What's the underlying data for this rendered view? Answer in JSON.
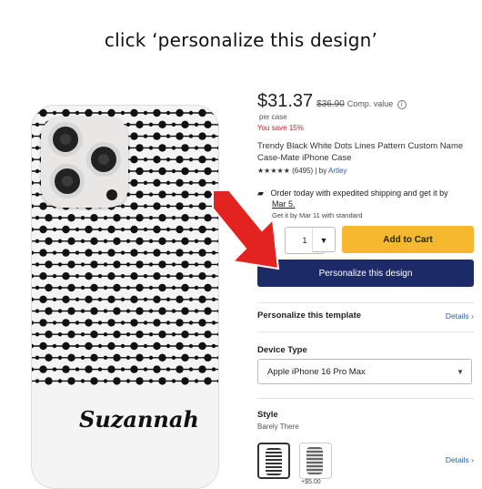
{
  "caption": "click ‘personalize this design’",
  "product": {
    "price": "$31.37",
    "original_price": "$36.90",
    "comp_value": "Comp. value",
    "per_unit": "per case",
    "savings": "You save 15%",
    "title": "Trendy Black White Dots Lines Pattern Custom Name Case-Mate iPhone Case",
    "stars": "★★★★★",
    "rating_count": "(6495)",
    "by_label": "| by",
    "author": "Artley",
    "personalized_name": "Suzannah"
  },
  "shipping": {
    "line1": "Order today with expedited shipping and get it by",
    "date": "Mar 5.",
    "line2": "Get it by Mar 11 with standard"
  },
  "purchase": {
    "quantity": "1",
    "add_to_cart": "Add to Cart",
    "personalize": "Personalize this design"
  },
  "template": {
    "heading": "Personalize this template",
    "details": "Details ›"
  },
  "device": {
    "label": "Device Type",
    "selected": "Apple iPhone 16 Pro Max"
  },
  "style": {
    "label": "Style",
    "selected": "Barely There",
    "other_price": "+$5.00",
    "details": "Details ›"
  },
  "colors": {
    "accent_yellow": "#f5b82e",
    "navy": "#1c2a68",
    "arrow_red": "#e3231f",
    "sale_red": "#c0272d",
    "link_blue": "#2a5db0"
  }
}
